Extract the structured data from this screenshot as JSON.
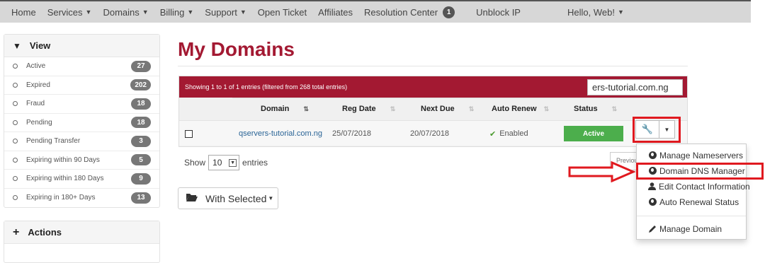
{
  "nav": {
    "items": [
      {
        "label": "Home",
        "caret": false
      },
      {
        "label": "Services",
        "caret": true
      },
      {
        "label": "Domains",
        "caret": true
      },
      {
        "label": "Billing",
        "caret": true
      },
      {
        "label": "Support",
        "caret": true
      },
      {
        "label": "Open Ticket",
        "caret": false
      },
      {
        "label": "Affiliates",
        "caret": false
      },
      {
        "label": "Resolution Center",
        "caret": false,
        "badge": "1"
      },
      {
        "label": "Unblock IP",
        "caret": false
      },
      {
        "label": "Hello, Web!",
        "caret": true
      }
    ]
  },
  "sidebar": {
    "view_title": "View",
    "filters": [
      {
        "label": "Active",
        "count": "27"
      },
      {
        "label": "Expired",
        "count": "202"
      },
      {
        "label": "Fraud",
        "count": "18"
      },
      {
        "label": "Pending",
        "count": "18"
      },
      {
        "label": "Pending Transfer",
        "count": "3"
      },
      {
        "label": "Expiring within 90 Days",
        "count": "5"
      },
      {
        "label": "Expiring within 180 Days",
        "count": "9"
      },
      {
        "label": "Expiring in 180+ Days",
        "count": "13"
      }
    ],
    "actions_title": "Actions"
  },
  "main": {
    "title": "My Domains",
    "table_info": "Showing 1 to 1 of 1 entries (filtered from 268 total entries)",
    "search_value": "ers-tutorial.com.ng",
    "columns": [
      "Domain",
      "Reg Date",
      "Next Due",
      "Auto Renew",
      "Status"
    ],
    "row": {
      "domain": "qservers-tutorial.com.ng",
      "reg_date": "25/07/2018",
      "next_due": "20/07/2018",
      "auto_renew": "Enabled",
      "status": "Active"
    },
    "show_label": "Show",
    "entries_value": "10",
    "entries_label": "entries",
    "previous_label": "Previous",
    "with_selected": "With Selected"
  },
  "dropdown": {
    "items": [
      {
        "label": "Manage Nameservers",
        "icon": "globe-icon"
      },
      {
        "label": "Domain DNS Manager",
        "icon": "globe-icon"
      },
      {
        "label": "Edit Contact Information",
        "icon": "user-icon"
      },
      {
        "label": "Auto Renewal Status",
        "icon": "globe-icon"
      }
    ],
    "manage_domain": "Manage Domain"
  },
  "colors": {
    "brand": "#a31932",
    "status_green": "#4cae4c",
    "highlight_red": "#e0191f"
  }
}
